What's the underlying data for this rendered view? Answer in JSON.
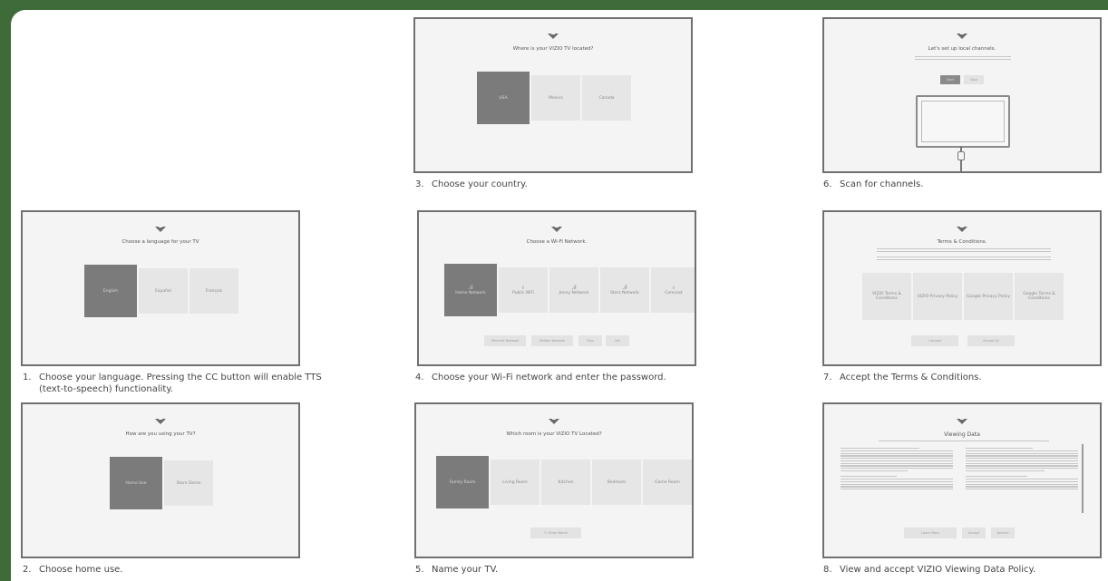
{
  "background_color": "#3f6a3a",
  "step1": {
    "title": "Choose a language for your TV",
    "options": [
      "English",
      "Español",
      "Français"
    ],
    "caption_number": "1.",
    "caption_line1": "Choose your language. Pressing the CC button will enable TTS",
    "caption_line2": "(text-to-speech) functionality."
  },
  "step2": {
    "title": "How are you using your TV?",
    "options": [
      "Home Use",
      "Store Demo"
    ],
    "caption_number": "2.",
    "caption": "Choose home use."
  },
  "step3": {
    "title": "Where is your VIZIO TV located?",
    "options": [
      "USA",
      "Mexico",
      "Canada"
    ],
    "caption_number": "3.",
    "caption": "Choose your country."
  },
  "step4": {
    "title": "Choose a Wi-Fi Network.",
    "networks": [
      "Home Network",
      "Public WiFi",
      "Jenny Network",
      "Starz Network",
      "Comcast"
    ],
    "buttons": [
      "Ethernet Network",
      "Hidden Network",
      "Skip",
      "Set"
    ],
    "caption_number": "4.",
    "caption": "Choose your Wi-Fi network and enter the password."
  },
  "step5": {
    "title": "Which room is your VIZIO TV Located?",
    "rooms": [
      "Family Room",
      "Living Room",
      "Kitchen",
      "Bedroom",
      "Game Room"
    ],
    "button": "Enter Name",
    "caption_number": "5.",
    "caption": "Name your TV."
  },
  "step6": {
    "title": "Let's set up local channels.",
    "buttons": [
      "Start",
      "Skip"
    ],
    "caption_number": "6.",
    "caption": "Scan for channels."
  },
  "step7": {
    "title": "Terms & Conditions.",
    "options": [
      "VIZIO Terms & Conditions",
      "VIZIO Privacy Policy",
      "Google Privacy Policy",
      "Google Terms & Conditions"
    ],
    "buttons": [
      "I Accept",
      "Accept All"
    ],
    "caption_number": "7.",
    "caption": "Accept the Terms & Conditions."
  },
  "step8": {
    "title": "Viewing Data",
    "buttons": [
      "Learn More",
      "Accept",
      "Decline"
    ],
    "caption_number": "8.",
    "caption": "View and accept VIZIO Viewing Data Policy."
  }
}
